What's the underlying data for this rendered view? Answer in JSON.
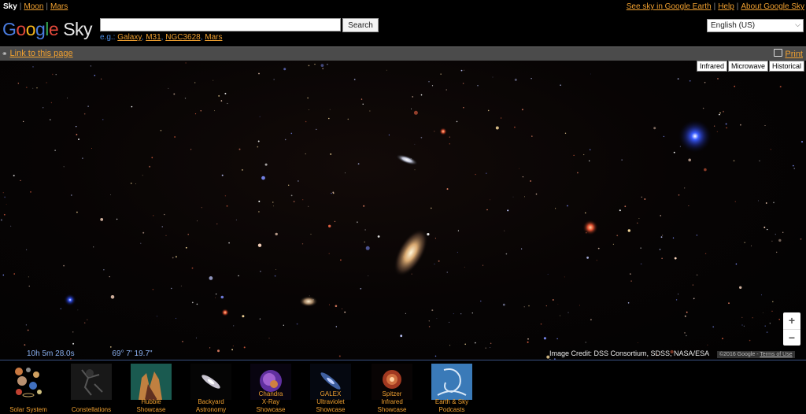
{
  "topnav": {
    "sky": "Sky",
    "moon": "Moon",
    "mars": "Mars",
    "see_sky": "See sky in Google Earth",
    "help": "Help",
    "about": "About Google Sky"
  },
  "header": {
    "logo_google": [
      "G",
      "o",
      "o",
      "g",
      "l",
      "e"
    ],
    "logo_sky": "Sky",
    "search_value": "",
    "search_button": "Search",
    "examples_prefix": "e.g.:",
    "examples": [
      "Galaxy",
      "M31",
      "NGC3628",
      "Mars"
    ],
    "language": "English (US)"
  },
  "linkbar": {
    "link_label": "Link to this page",
    "print_label": "Print"
  },
  "layers": [
    "Infrared",
    "Microwave",
    "Historical"
  ],
  "status": {
    "ra": "10h 5m 28.0s",
    "dec": "69° 7' 19.7\"",
    "credit": "Image Credit: DSS Consortium, SDSS, NASA/ESA",
    "copyright": "©2016 Google -",
    "terms": "Terms of Use"
  },
  "zoom": {
    "in": "+",
    "out": "−"
  },
  "showcases": [
    {
      "label": [
        "Solar System"
      ],
      "icon": "solar-system-icon"
    },
    {
      "label": [
        "Constellations"
      ],
      "icon": "constellations-icon"
    },
    {
      "label": [
        "Hubble",
        "Showcase"
      ],
      "icon": "hubble-icon"
    },
    {
      "label": [
        "Backyard",
        "Astronomy"
      ],
      "icon": "backyard-icon"
    },
    {
      "label": [
        "Chandra",
        "X-Ray",
        "Showcase"
      ],
      "icon": "chandra-icon"
    },
    {
      "label": [
        "GALEX",
        "Ultraviolet",
        "Showcase"
      ],
      "icon": "galex-icon"
    },
    {
      "label": [
        "Spitzer",
        "Infrared",
        "Showcase"
      ],
      "icon": "spitzer-icon"
    },
    {
      "label": [
        "Earth & Sky",
        "Podcasts"
      ],
      "icon": "earth-sky-icon"
    }
  ]
}
